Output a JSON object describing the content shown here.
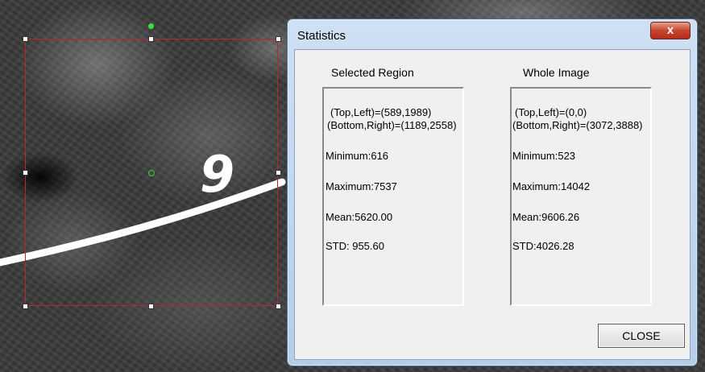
{
  "dialog": {
    "title": "Statistics",
    "close_x_glyph": "x",
    "close_button_label": "CLOSE"
  },
  "selected_region": {
    "heading": "Selected Region",
    "top_left": "(Top,Left)=(589,1989)",
    "bottom_right": "(Bottom,Right)=(1189,2558)",
    "minimum": "Minimum:616",
    "maximum": "Maximum:7537",
    "mean": "Mean:5620.00",
    "std": "STD: 955.60"
  },
  "whole_image": {
    "heading": "Whole Image",
    "top_left": "(Top,Left)=(0,0)",
    "bottom_right": "(Bottom,Right)=(3072,3888)",
    "minimum": "Minimum:523",
    "maximum": "Maximum:14042",
    "mean": "Mean:9606.26",
    "std": "STD:4026.28"
  },
  "image": {
    "marker_glyph": "9"
  },
  "colors": {
    "selection_border": "#c0242b",
    "handle_green": "#38e038"
  }
}
